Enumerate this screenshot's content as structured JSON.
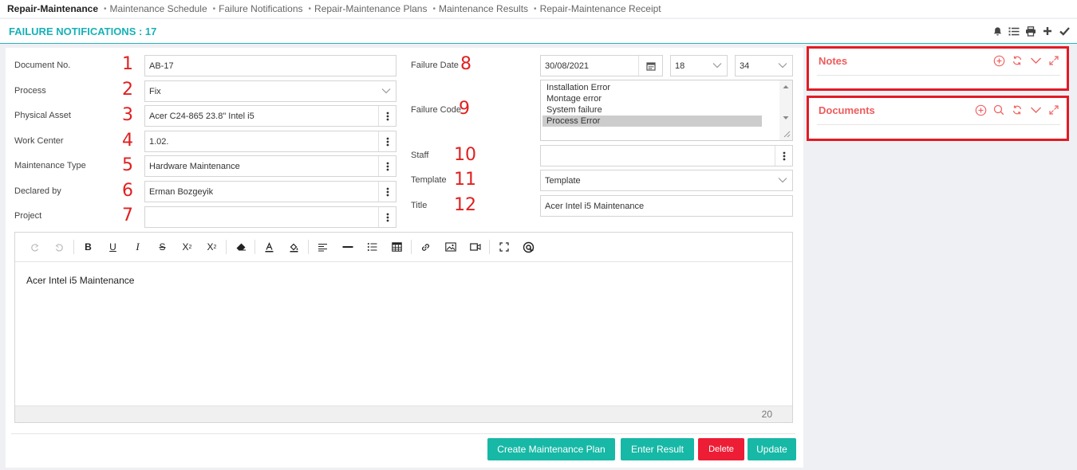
{
  "breadcrumbs": [
    {
      "label": "Repair-Maintenance",
      "active": true
    },
    {
      "label": "Maintenance Schedule",
      "active": false
    },
    {
      "label": "Failure Notifications",
      "active": false
    },
    {
      "label": "Repair-Maintenance Plans",
      "active": false
    },
    {
      "label": "Maintenance Results",
      "active": false
    },
    {
      "label": "Repair-Maintenance Receipt",
      "active": false
    }
  ],
  "header": {
    "title": "FAILURE NOTIFICATIONS : 17",
    "actions": [
      "bell-icon",
      "list-icon",
      "print-icon",
      "plus-icon",
      "check-icon"
    ]
  },
  "form": {
    "left": [
      {
        "label": "Document No.",
        "marker": "1",
        "value": "AB-17",
        "type": "text"
      },
      {
        "label": "Process",
        "marker": "2",
        "value": "Fix",
        "type": "select"
      },
      {
        "label": "Physical Asset",
        "marker": "3",
        "value": "Acer C24-865 23.8\" Intel i5",
        "type": "lookup"
      },
      {
        "label": "Work Center",
        "marker": "4",
        "value": "1.02.",
        "type": "lookup"
      },
      {
        "label": "Maintenance Type",
        "marker": "5",
        "value": "Hardware Maintenance",
        "type": "lookup"
      },
      {
        "label": "Declared by",
        "marker": "6",
        "value": "Erman Bozgeyik",
        "type": "lookup"
      },
      {
        "label": "Project",
        "marker": "7",
        "value": "",
        "type": "lookup"
      }
    ],
    "failure_date": {
      "label": "Failure Date",
      "marker": "8",
      "date": "30/08/2021",
      "hour": "18",
      "minute": "34"
    },
    "failure_code": {
      "label": "Failure Code",
      "marker": "9",
      "options": [
        "Installation Error",
        "Montage error",
        "System failure",
        "Process Error"
      ],
      "selected": "Process Error"
    },
    "staff": {
      "label": "Staff",
      "marker": "10",
      "value": ""
    },
    "template": {
      "label": "Template",
      "marker": "11",
      "value": "Template"
    },
    "title_field": {
      "label": "Title",
      "marker": "12",
      "value": "Acer Intel i5 Maintenance"
    }
  },
  "editor": {
    "content": "Acer Intel i5 Maintenance",
    "word_count": "20"
  },
  "buttons": {
    "create_plan": "Create Maintenance Plan",
    "enter_result": "Enter Result",
    "delete": "Delete",
    "update": "Update"
  },
  "panels": {
    "notes": {
      "title": "Notes",
      "tools": [
        "add-icon",
        "refresh-icon",
        "collapse-icon",
        "expand-icon"
      ]
    },
    "documents": {
      "title": "Documents",
      "tools": [
        "add-icon",
        "search-icon",
        "refresh-icon",
        "collapse-icon",
        "expand-icon"
      ]
    }
  },
  "colors": {
    "accent_teal": "#17b1b8",
    "button_teal": "#17b8a6",
    "danger_red": "#ed1d35",
    "panel_title": "#ee5b5b",
    "marker_red": "#e02020"
  }
}
